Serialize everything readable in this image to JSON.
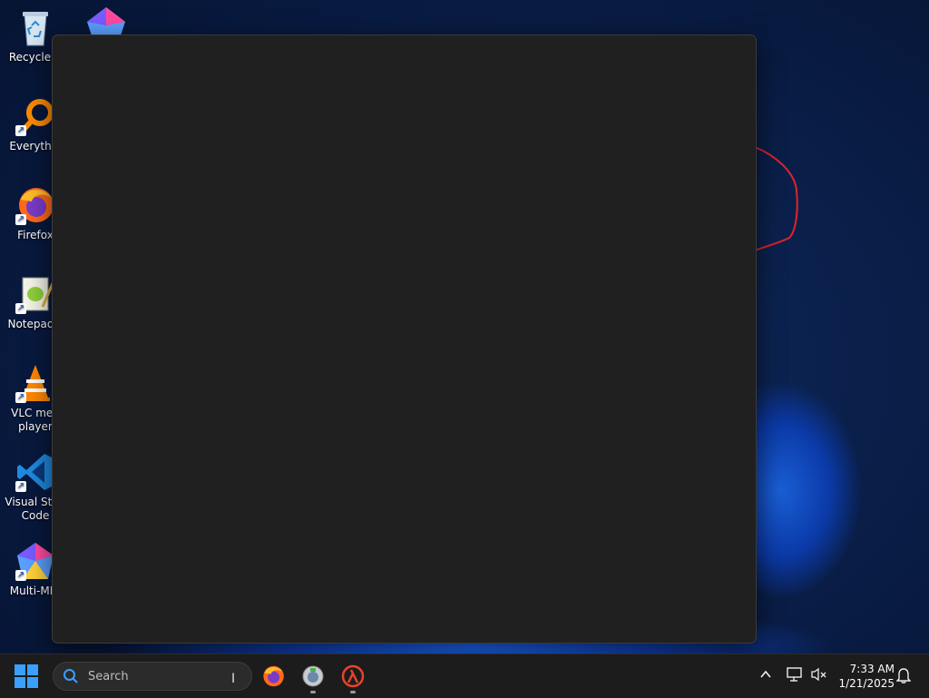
{
  "desktop": {
    "icons": [
      {
        "label": "Recycle B",
        "icon": "recycle-bin-icon"
      },
      {
        "label": "Everythin",
        "icon": "everything-search-icon"
      },
      {
        "label": "Firefox",
        "icon": "firefox-icon"
      },
      {
        "label": "Notepad+",
        "icon": "notepad-plus-plus-icon"
      },
      {
        "label": "VLC med\nplayer",
        "icon": "vlc-icon"
      },
      {
        "label": "Visual Stud\nCode",
        "icon": "vscode-icon"
      },
      {
        "label": "Multi-MEr",
        "icon": "multi-memory-icon"
      }
    ]
  },
  "taskbar": {
    "search_placeholder": "Search",
    "apps": [
      "firefox-icon",
      "gimp-icon",
      "half-life-icon"
    ],
    "clock": {
      "time": "7:33 AM",
      "date": "1/21/2025"
    }
  },
  "colors": {
    "window_bg": "#202020",
    "taskbar_bg": "#1c1c1c",
    "accent": "#3aa0ff"
  }
}
